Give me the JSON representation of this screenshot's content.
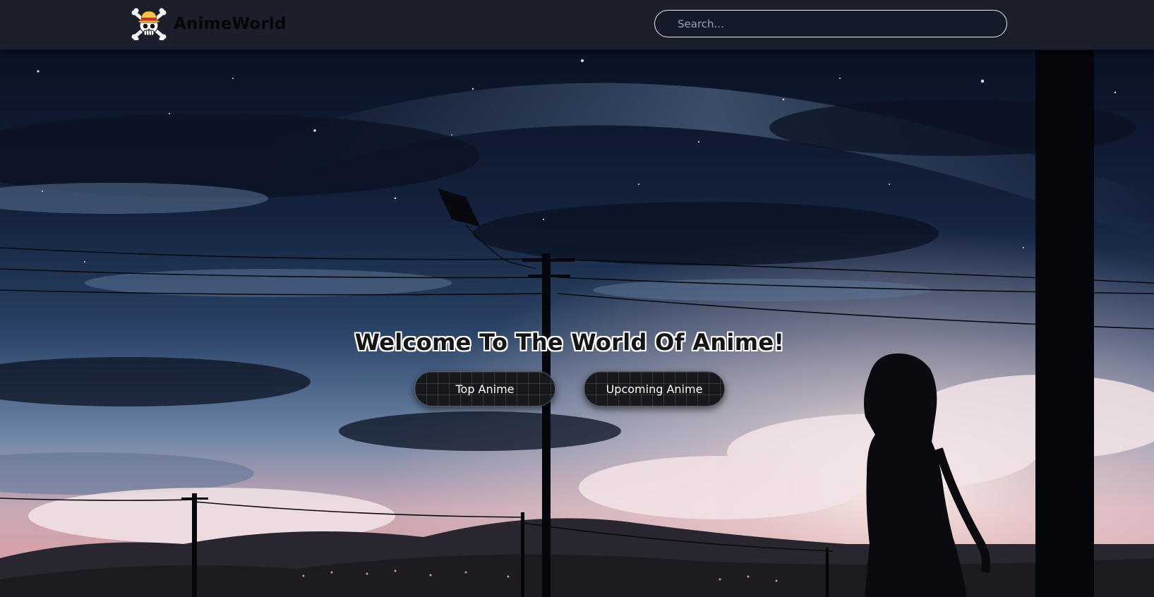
{
  "navbar": {
    "brand_name": "AnimeWorld",
    "logo_icon": "straw-hat-jolly-roger-icon",
    "search_placeholder": "Search..."
  },
  "hero": {
    "title": "Welcome To The World Of Anime!",
    "buttons": {
      "top_anime": "Top Anime",
      "upcoming_anime": "Upcoming Anime"
    },
    "background": "night-sky-kite-power-lines-girl-silhouette"
  },
  "colors": {
    "navbar_bg": "#1b1f2b",
    "sky_top": "#0b1326",
    "sky_horizon": "#e9a6a8",
    "button_bg": "#17181c"
  }
}
